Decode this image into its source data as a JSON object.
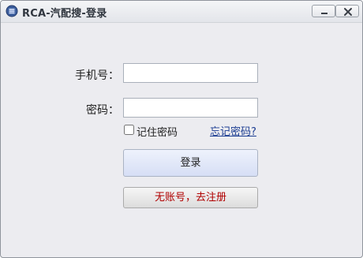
{
  "window": {
    "title": "RCA-汽配搜-登录",
    "minimize_icon": "minimize-icon",
    "close_icon": "close-icon",
    "app_icon": "app-logo-icon"
  },
  "form": {
    "phone_label": "手机号：",
    "phone_value": "",
    "password_label": "密码：",
    "password_value": "",
    "remember_label": "记住密码",
    "remember_checked": false,
    "forgot_link": "忘记密码?",
    "login_button": "登录",
    "register_button": "无账号，去注册"
  },
  "colors": {
    "window_bg": "#ececf0",
    "register_text": "#b00000",
    "link": "#1b3d92"
  }
}
